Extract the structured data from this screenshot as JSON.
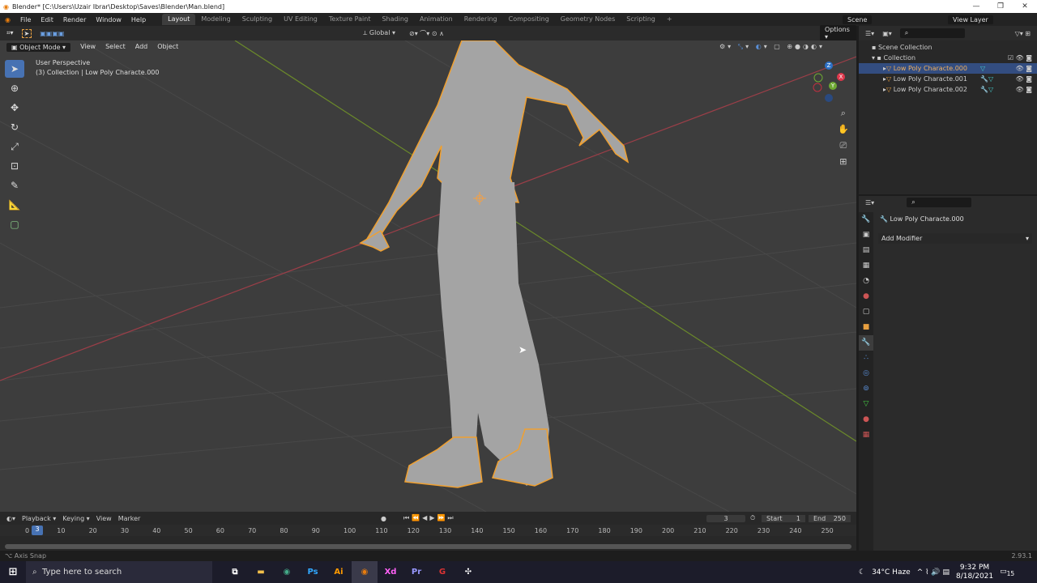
{
  "window": {
    "title": "Blender* [C:\\Users\\Uzair Ibrar\\Desktop\\Saves\\Blender\\Man.blend]",
    "minimize": "—",
    "maximize": "❐",
    "close": "✕"
  },
  "menu": [
    "File",
    "Edit",
    "Render",
    "Window",
    "Help"
  ],
  "workspaces": [
    "Layout",
    "Modeling",
    "Sculpting",
    "UV Editing",
    "Texture Paint",
    "Shading",
    "Animation",
    "Rendering",
    "Compositing",
    "Geometry Nodes",
    "Scripting",
    "+"
  ],
  "scene": "Scene",
  "view_layer": "View Layer",
  "viewport_header": {
    "mode": "Object Mode",
    "menus": [
      "View",
      "Select",
      "Add",
      "Object"
    ],
    "orientation": "Global",
    "options": "Options"
  },
  "viewport": {
    "perspective": "User Perspective",
    "collection_info": "(3) Collection | Low Poly Characte.000",
    "gizmo": {
      "x": "X",
      "y": "Y",
      "z": "Z"
    }
  },
  "outliner": {
    "scene_collection": "Scene Collection",
    "collection": "Collection",
    "objects": [
      "Low Poly Characte.000",
      "Low Poly Characte.001",
      "Low Poly Characte.002"
    ]
  },
  "properties": {
    "object_name": "Low Poly Characte.000",
    "add_modifier": "Add Modifier"
  },
  "timeline": {
    "menus": [
      "Playback",
      "Keying",
      "View",
      "Marker"
    ],
    "current_frame": "3",
    "start_label": "Start",
    "start": "1",
    "end_label": "End",
    "end": "250",
    "ticks": [
      "0",
      "10",
      "20",
      "30",
      "40",
      "50",
      "60",
      "70",
      "80",
      "90",
      "100",
      "110",
      "120",
      "130",
      "140",
      "150",
      "160",
      "170",
      "180",
      "190",
      "200",
      "210",
      "220",
      "230",
      "240",
      "250"
    ],
    "playhead": "3"
  },
  "status": {
    "hint": "Axis Snap",
    "version": "2.93.1"
  },
  "taskbar": {
    "search_placeholder": "Type here to search",
    "weather": "34°C  Haze",
    "time": "9:32 PM",
    "date": "8/18/2021",
    "notifications": "15"
  }
}
